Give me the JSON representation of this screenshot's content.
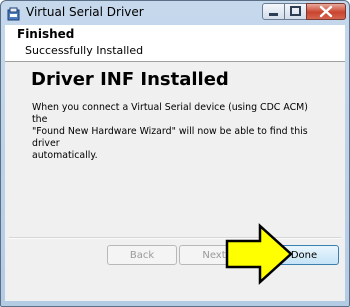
{
  "window": {
    "title": "Virtual Serial Driver"
  },
  "header": {
    "title": "Finished",
    "subtitle": "Successfully Installed"
  },
  "main": {
    "heading": "Driver INF Installed",
    "body_line1": "When you connect a Virtual Serial device (using CDC ACM) the",
    "body_line2": "\"Found New Hardware Wizard\" will now be able to find this driver",
    "body_line3": "automatically."
  },
  "buttons": {
    "back": "Back",
    "next": "Next",
    "done": "Done"
  },
  "colors": {
    "arrow_fill": "#ffff00",
    "close_button": "#c9452f",
    "content_bg": "#f0f0f0"
  },
  "icons": [
    "app-icon",
    "minimize-icon",
    "maximize-icon",
    "close-icon",
    "arrow-pointer-icon"
  ]
}
